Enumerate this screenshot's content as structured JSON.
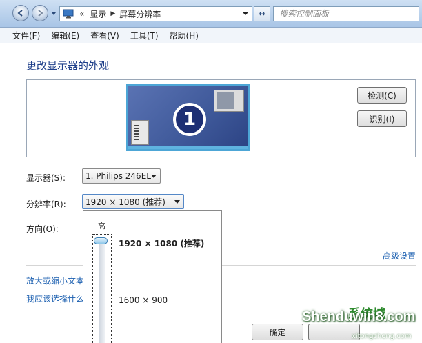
{
  "address_bar": {
    "crumb_prefix": "«",
    "crumbs": [
      "显示",
      "屏幕分辨率"
    ],
    "search_placeholder": "搜索控制面板"
  },
  "menu": {
    "items": [
      "文件(F)",
      "编辑(E)",
      "查看(V)",
      "工具(T)",
      "帮助(H)"
    ]
  },
  "main": {
    "title": "更改显示器的外观",
    "monitor_number": "1",
    "detect_button": "检测(C)",
    "identify_button": "识别(I)",
    "display_label": "显示器(S):",
    "display_value": "1. Philips 246EL",
    "resolution_label": "分辨率(R):",
    "resolution_value": "1920 × 1080 (推荐)",
    "orientation_label": "方向(O):",
    "advanced_link": "高级设置",
    "scale_link": "放大或缩小文本",
    "choose_link": "我应该选择什么",
    "ok_button": "确定"
  },
  "resolution_dropdown": {
    "high_label": "高",
    "options": [
      "1920 × 1080 (推荐)",
      "1600 × 900"
    ],
    "slider_level": 1.0
  },
  "watermark": {
    "brand": "Shenduwin8.com",
    "brand_cn": "系统城",
    "url": "xitongcheng.com"
  },
  "colors": {
    "link": "#1b5fb0",
    "title": "#1e3f8a",
    "monitor_border": "#4da6d6"
  }
}
